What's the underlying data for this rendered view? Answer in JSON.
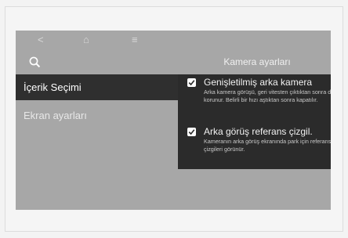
{
  "header": {
    "title": "Kamera ayarları",
    "nav_back": "<",
    "nav_home": "⌂",
    "nav_menu": "≡"
  },
  "sidebar": {
    "items": [
      {
        "label": "İçerik Seçimi",
        "active": true
      },
      {
        "label": "Ekran ayarları",
        "active": false
      }
    ]
  },
  "options": [
    {
      "label": "Genişletilmiş arka kamera",
      "checked": true,
      "description": "Arka kamera görüşü, geri vitesten çıktıktan sonra da korunur. Belirli bir hızı aştıktan sonra kapatılır."
    },
    {
      "label": "Arka görüş referans çizgil.",
      "checked": true,
      "description": "Kameranın arka görüş ekranında park için referans çizgileri görünür."
    }
  ],
  "colors": {
    "screen_bg": "#a7a7a7",
    "panel_bg": "#2b2b2b",
    "active_item_bg": "#2f2f2f"
  }
}
